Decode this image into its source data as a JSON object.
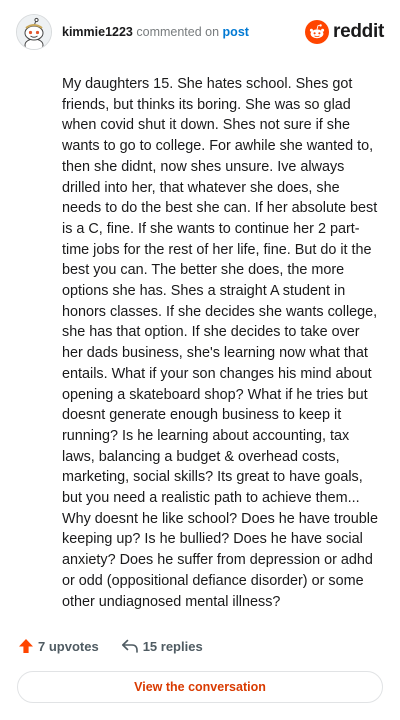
{
  "header": {
    "username": "kimmie1223",
    "action_text": "commented on",
    "post_link": "post",
    "brand": "reddit"
  },
  "comment": {
    "text": "My daughters 15. She hates school. Shes got friends, but thinks its boring. She was so glad when covid shut it down. Shes not sure if she wants to go to college. For awhile she wanted to, then she didnt, now shes unsure. Ive always drilled into her, that whatever she does, she needs to do the best she can. If her absolute best is a C, fine. If she wants to continue her 2 part-time jobs for the rest of her life, fine. But do it the best you can. The better she does, the more options she has. Shes a straight A student in honors classes. If she decides she wants college, she has that option. If she decides to take over her dads business, she's learning now what that entails. What if your son changes his mind about opening a skateboard shop? What if he tries but doesnt generate enough business to keep it running? Is he learning about accounting, tax laws, balancing a budget & overhead costs, marketing, social skills? Its great to have goals, but you need a realistic path to achieve them... Why doesnt he like school? Does he have trouble keeping up? Is he bullied? Does he have social anxiety? Does he suffer from depression or adhd or odd (oppositional defiance disorder) or some other undiagnosed mental illness?"
  },
  "actions": {
    "upvotes": "7 upvotes",
    "replies": "15 replies"
  },
  "footer": {
    "view_label": "View the conversation"
  },
  "colors": {
    "brand_orange": "#ff4500",
    "link_blue": "#0079d3",
    "button_text": "#d93a00"
  },
  "icons": {
    "avatar": "snoo-avatar-icon",
    "brand": "reddit-logo-icon",
    "upvote": "upvote-arrow-icon",
    "reply": "reply-arrow-icon"
  }
}
